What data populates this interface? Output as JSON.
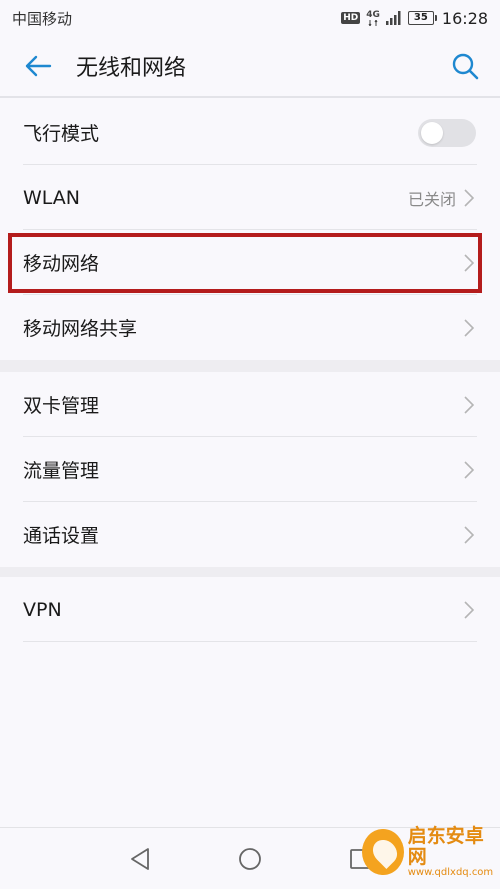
{
  "status_bar": {
    "carrier": "中国移动",
    "hd": "HD",
    "network": "4G",
    "battery": "35",
    "time": "16:28"
  },
  "header": {
    "title": "无线和网络",
    "back_icon": "arrow-left-icon",
    "search_icon": "search-icon",
    "accent_color": "#1e88d0"
  },
  "groups": [
    {
      "items": [
        {
          "label": "飞行模式",
          "type": "toggle",
          "state": "off"
        },
        {
          "label": "WLAN",
          "value": "已关闭"
        },
        {
          "label": "移动网络"
        },
        {
          "label": "移动网络共享"
        }
      ]
    },
    {
      "items": [
        {
          "label": "双卡管理"
        },
        {
          "label": "流量管理"
        },
        {
          "label": "通话设置"
        }
      ]
    },
    {
      "items": [
        {
          "label": "VPN"
        }
      ]
    }
  ],
  "highlight_color": "#b41c1c",
  "watermark": {
    "title": "启东安卓网",
    "url": "www.qdlxdq.com"
  }
}
